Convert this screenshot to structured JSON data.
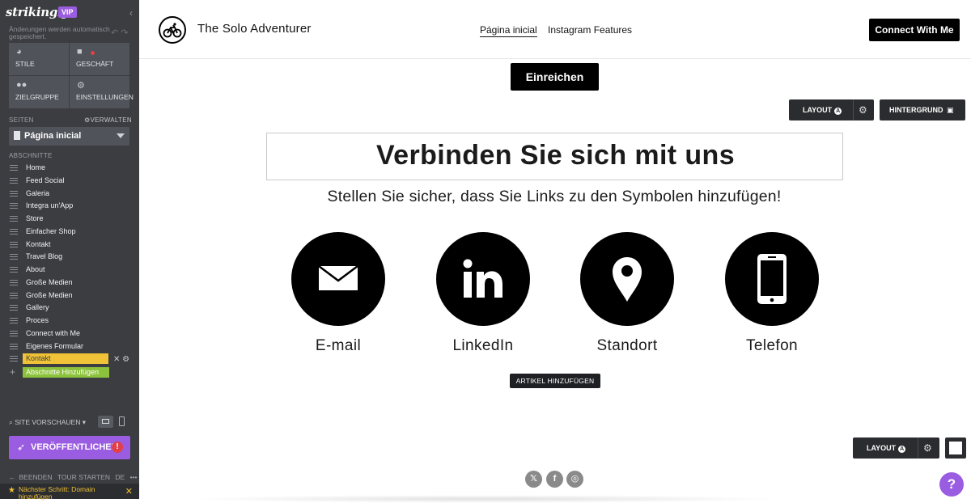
{
  "sidebar": {
    "brand": "strikingly",
    "badge": "VIP",
    "autosave_note": "Änderungen werden automatisch gespeichert.",
    "tiles": [
      {
        "label": "STILE",
        "icon": "palette-icon"
      },
      {
        "label": "GESCHÄFT",
        "icon": "shop-bag-icon"
      },
      {
        "label": "ZIELGRUPPE",
        "icon": "people-icon"
      },
      {
        "label": "EINSTELLUNGEN",
        "icon": "gear-icon"
      }
    ],
    "pages_label": "SEITEN",
    "manage_label": "VERWALTEN",
    "current_page": "Página inicial",
    "sections_label": "ABSCHNITTE",
    "sections": [
      "Home",
      "Feed Social",
      "Galeria",
      "Integra un'App",
      "Store",
      "Einfacher Shop",
      "Kontakt",
      "Travel Blog",
      "About",
      "Große Medien",
      "Große Medien",
      "Gallery",
      "Proces",
      "Connect with Me",
      "Eigenes Formular"
    ],
    "active_section": "Kontakt",
    "add_section_label": "Abschnitte Hinzufügen",
    "preview_label": "SITE VORSCHAUEN",
    "publish_label": "VERÖFFENTLICHEN",
    "publish_alert": "!",
    "footer_links": [
      "BEENDEN",
      "TOUR STARTEN",
      "DE",
      "•••"
    ],
    "next_step": "Nächster Schritt: Domain hinzufügen"
  },
  "header": {
    "site_title": "The Solo Adventurer",
    "nav": [
      "Página inicial",
      "Instagram Features"
    ],
    "cta": "Connect With Me"
  },
  "main": {
    "submit_label": "Einreichen",
    "layout_label": "LAYOUT",
    "layout_badge": "A",
    "background_label": "HINTERGRUND",
    "heading": "Verbinden Sie sich mit uns",
    "subheading": "Stellen Sie sicher, dass Sie Links zu den Symbolen hinzufügen!",
    "contacts": [
      {
        "label": "E-mail",
        "icon": "envelope-icon"
      },
      {
        "label": "LinkedIn",
        "icon": "linkedin-icon"
      },
      {
        "label": "Standort",
        "icon": "location-pin-icon"
      },
      {
        "label": "Telefon",
        "icon": "smartphone-icon"
      }
    ],
    "add_article_label": "ARTIKEL HINZUFÜGEN",
    "social_icons": [
      "x-icon",
      "facebook-icon",
      "instagram-icon"
    ],
    "help": "?"
  },
  "colors": {
    "sidebar_bg": "#3b3d41",
    "accent_purple": "#9a5ce0",
    "active_yellow": "#f0c237",
    "add_green": "#8cc23c"
  }
}
